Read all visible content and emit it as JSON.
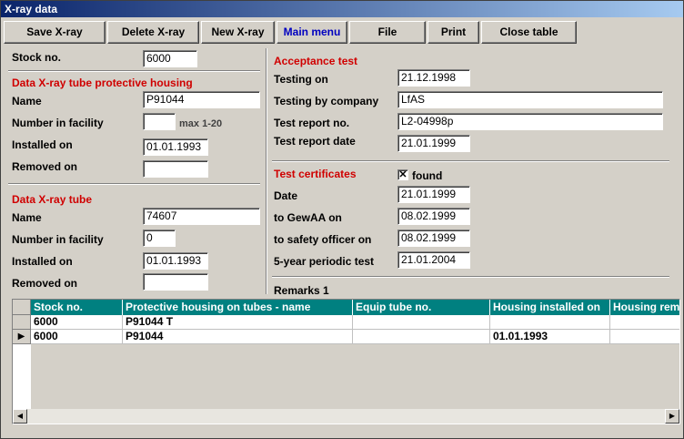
{
  "window": {
    "title": "X-ray data"
  },
  "toolbar": {
    "save": "Save X-ray",
    "delete": "Delete X-ray",
    "new": "New X-ray",
    "main_menu": "Main menu",
    "file": "File",
    "print": "Print",
    "close_table": "Close table"
  },
  "left": {
    "stock_no_label": "Stock no.",
    "stock_no": "6000",
    "housing": {
      "header": "Data X-ray tube protective housing",
      "name_label": "Name",
      "name": "P91044",
      "number_label": "Number in facility",
      "number": "",
      "number_hint": "max 1-20",
      "installed_label": "Installed on",
      "installed": "01.01.1993",
      "removed_label": "Removed on",
      "removed": ""
    },
    "tube": {
      "header": "Data X-ray tube",
      "name_label": "Name",
      "name": "74607",
      "number_label": "Number in facility",
      "number": "0",
      "installed_label": "Installed on",
      "installed": "01.01.1993",
      "removed_label": "Removed on",
      "removed": ""
    }
  },
  "acceptance": {
    "header": "Acceptance test",
    "testing_on_label": "Testing on",
    "testing_on": "21.12.1998",
    "company_label": "Testing by company",
    "company": "LfAS",
    "report_no_label": "Test report no.",
    "report_no": "L2-04998p",
    "report_date_label": "Test report date",
    "report_date": "21.01.1999"
  },
  "certificates": {
    "header": "Test certificates",
    "found_label": "found",
    "found_mark": "✕",
    "date_label": "Date",
    "date": "21.01.1999",
    "gewaa_label": "to GewAA on",
    "gewaa": "08.02.1999",
    "safety_label": "to safety officer on",
    "safety": "08.02.1999",
    "periodic_label": "5-year periodic test",
    "periodic": "21.01.2004"
  },
  "remarks": {
    "label": "Remarks 1"
  },
  "grid": {
    "columns": [
      "Stock no.",
      "Protective housing on tubes - name",
      "Equip tube no.",
      "Housing installed on",
      "Housing removed on"
    ],
    "rows": [
      [
        "6000",
        "P91044 T",
        "",
        "",
        ""
      ],
      [
        "6000",
        "P91044",
        "",
        "01.01.1993",
        ""
      ]
    ],
    "current_row_marker": "▶"
  }
}
